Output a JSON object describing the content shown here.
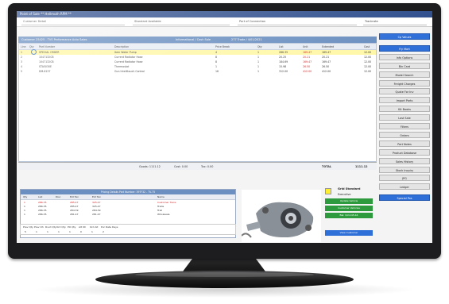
{
  "window": {
    "title": "Point of Sale  **  Hellmuth RPM  **"
  },
  "header_fields": [
    {
      "label": "Customer Detail"
    },
    {
      "label": "Standard Available"
    },
    {
      "label": "Port of Connection"
    },
    {
      "label": "Trackrate"
    }
  ],
  "customer_bar": {
    "left": "Customer   25425 - TVS Performance Auto Sales",
    "mid": "Informational / Cash Sale",
    "right": "277 Trade / 4/01/2021"
  },
  "grid": {
    "columns": [
      "Line",
      "Qty",
      "Part Number",
      "Description",
      "Price Break",
      "Qty",
      "List",
      "Unit",
      "Extended",
      "Cost"
    ],
    "rows": [
      [
        "1",
        "",
        "SPECIAL ORDER",
        "Item Water Pump",
        "4",
        "1",
        "286.35",
        "189.47",
        "189.47",
        "12.00"
      ],
      [
        "2",
        "",
        "1047132CB",
        "Current Radiator Hose",
        "8",
        "1",
        "20.25",
        "20.21",
        "20.21",
        "12.00"
      ],
      [
        "3",
        "",
        "1047132CB",
        "Current Radiator Hose",
        "8",
        "1",
        "184.69",
        "169.47",
        "169.47",
        "12.00"
      ],
      [
        "4",
        "",
        "STA5030E",
        "Thermostat",
        "1",
        "1",
        "15.98",
        "26.50",
        "26.50",
        "12.00"
      ],
      [
        "5",
        "",
        "DM-6137",
        "Gun Intellitouch Control",
        "16",
        "1",
        "312.00",
        "412.00",
        "412.00",
        "12.00"
      ]
    ]
  },
  "totals": {
    "goods": "Goods: 1111.12",
    "cost": "Cost: 0.00",
    "tax": "Tax: 0.00",
    "total_label": "TOTAL",
    "total_value": "1111.12"
  },
  "pricing": {
    "title": "Pricing Details  Part Number: 397F32 - TV-75",
    "columns": [
      "Qty",
      "List",
      "Disc",
      "Ext Tax",
      "Ext Tax",
      "Name"
    ],
    "rows": [
      [
        "1",
        "286.35",
        "",
        "285.47",
        "325.47",
        "Customer Trans"
      ],
      [
        "1",
        "286.35",
        "",
        "285.47",
        "325.47",
        "Trade"
      ],
      [
        "1",
        "286.35",
        "",
        "284.39",
        "284.39",
        "Trail"
      ],
      [
        "1",
        "286.35",
        "",
        "281.47",
        "281.47",
        "Wholesale"
      ]
    ],
    "status_labels": [
      "Prev Qty",
      "Prev Oh",
      "Rcvd Qty",
      "Ord Qty",
      "PO Qty",
      "Alt Oh",
      "Ord Alt",
      "Pur Date",
      "Days"
    ],
    "status_values": [
      "5",
      "1",
      "1",
      "1",
      "1",
      "0",
      "1",
      "2",
      ""
    ]
  },
  "customer_panel": {
    "name": "Grid Standard",
    "sub": "Executive",
    "btn1": "Update Vehicle",
    "btn2": "Customer Vehicles",
    "btn3": "Bal: $11145.44",
    "btn4": "View Customer"
  },
  "sidebar": [
    {
      "label": "Cp Values",
      "style": "blue"
    },
    {
      "label": "Fly Mart",
      "style": "blue"
    },
    {
      "label": "Info Options",
      "style": "grey"
    },
    {
      "label": "Bin Card",
      "style": "grey"
    },
    {
      "label": "Model Search",
      "style": "grey"
    },
    {
      "label": "Freight Charges",
      "style": "grey"
    },
    {
      "label": "Quote For Inv",
      "style": "grey"
    },
    {
      "label": "Import Parts",
      "style": "grey"
    },
    {
      "label": "Kit Books",
      "style": "grey"
    },
    {
      "label": "Last Sale",
      "style": "grey"
    },
    {
      "label": "Filters",
      "style": "grey"
    },
    {
      "label": "Orders",
      "style": "grey"
    },
    {
      "label": "Part Notes",
      "style": "grey"
    },
    {
      "label": "Product Database",
      "style": "grey"
    },
    {
      "label": "Sales History",
      "style": "grey"
    },
    {
      "label": "Stock Inquiry",
      "style": "grey"
    },
    {
      "label": "JPG",
      "style": "grey"
    },
    {
      "label": "Ledger",
      "style": "grey"
    },
    {
      "label": "Special Pos",
      "style": "blue"
    }
  ],
  "colors": {
    "titlebar": "#2a4a8a",
    "accent_blue": "#2f6fd8",
    "green": "#2d9a3d",
    "highlight_yellow": "#fff7a8",
    "red_text": "#d11e1e"
  }
}
